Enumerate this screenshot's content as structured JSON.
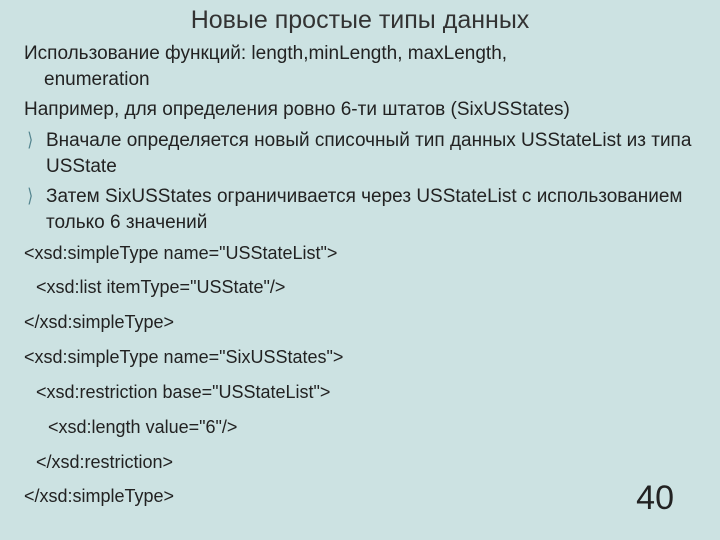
{
  "title": "Новые простые типы данных",
  "intro_line1": "Использование функций: length,minLength, maxLength,",
  "intro_line2": "enumeration",
  "example_intro": "Например, для определения ровно 6-ти штатов (SixUSStates)",
  "bullets": [
    "Вначале определяется новый списочный тип данных USStateList из типа USState",
    "Затем SixUSStates ограничивается через USStateList с использованием только 6 значений"
  ],
  "code": [
    "<xsd:simpleType name=\"USStateList\">",
    "<xsd:list itemType=\"USState\"/>",
    "</xsd:simpleType>",
    "<xsd:simpleType name=\"SixUSStates\">",
    "<xsd:restriction base=\"USStateList\">",
    "<xsd:length value=\"6\"/>",
    "</xsd:restriction>",
    "</xsd:simpleType>"
  ],
  "page_number": "40"
}
